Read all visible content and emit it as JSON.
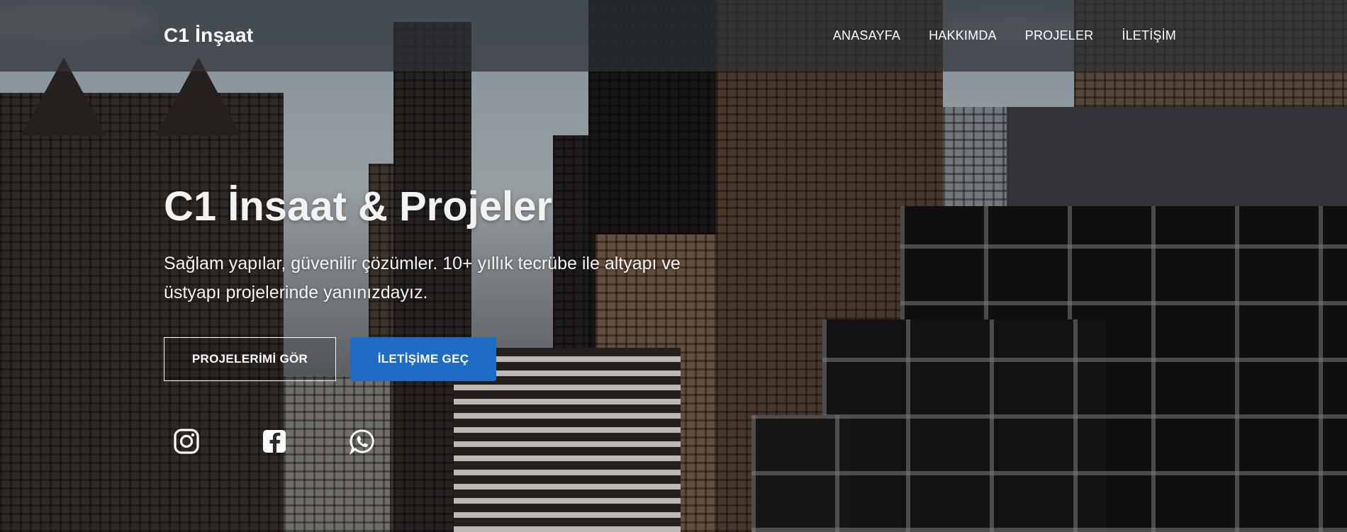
{
  "navbar": {
    "brand": "C1 İnşaat",
    "links": [
      {
        "label": "ANASAYFA"
      },
      {
        "label": "HAKKIMDA"
      },
      {
        "label": "PROJELER"
      },
      {
        "label": "İLETİŞİM"
      }
    ]
  },
  "hero": {
    "title": "C1 İnsaat & Projeler",
    "subtitle": "Sağlam yapılar, güvenilir çözümler. 10+ yıllık tecrübe ile altyapı ve üstyapı projelerinde yanınızdayız.",
    "buttons": {
      "projects": "PROJELERİMİ GÖR",
      "contact": "İLETİŞİME GEÇ"
    }
  },
  "social": [
    {
      "icon": "instagram-icon"
    },
    {
      "icon": "facebook-icon"
    },
    {
      "icon": "whatsapp-icon"
    }
  ],
  "colors": {
    "accent": "#1e6bc6",
    "navbar": "#2d3034"
  }
}
